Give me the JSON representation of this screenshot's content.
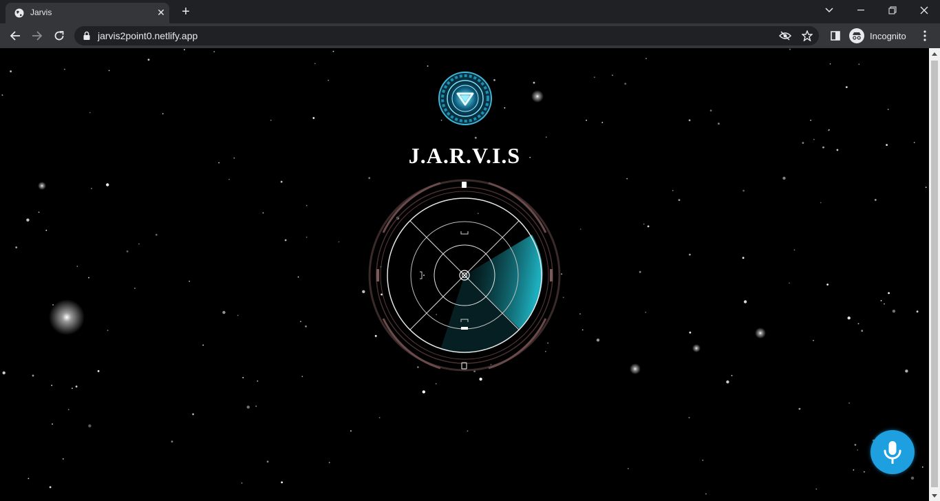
{
  "browser": {
    "tab": {
      "title": "Jarvis",
      "favicon": "globe-icon"
    },
    "new_tab_label": "+",
    "url": "jarvis2point0.netlify.app",
    "profile_label": "Incognito"
  },
  "page": {
    "title": "J.A.R.V.I.S",
    "logo_icon": "arc-reactor-icon",
    "mic_icon": "microphone-icon",
    "accent_color": "#1ea0e0",
    "radar_color": "#1fb8c8"
  }
}
